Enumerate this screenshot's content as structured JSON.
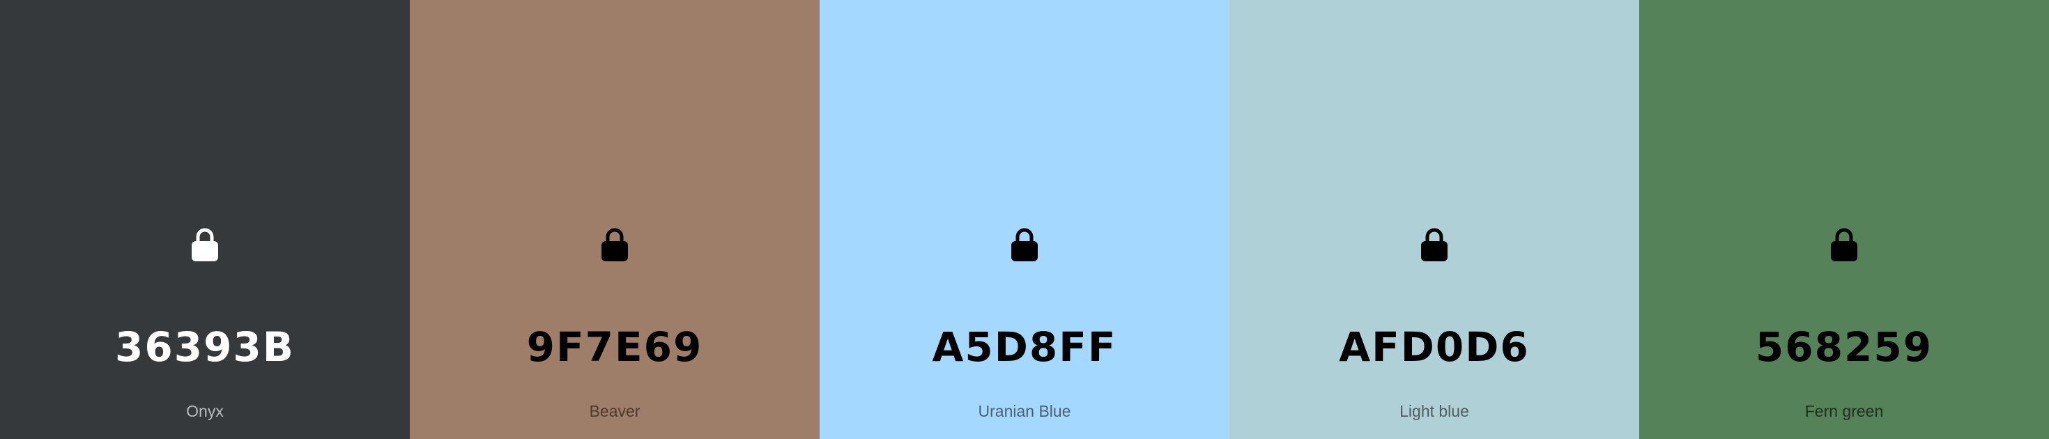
{
  "palette": {
    "colors": [
      {
        "hex": "36393B",
        "name": "Onyx",
        "background": "#36393B",
        "text_color": "#FFFFFF",
        "name_color": "#B9BBBC",
        "icon_color": "#FFFFFF",
        "icon": "lock-icon"
      },
      {
        "hex": "9F7E69",
        "name": "Beaver",
        "background": "#9F7E69",
        "text_color": "#000000",
        "name_color": "#4B3A30",
        "icon_color": "#000000",
        "icon": "lock-icon"
      },
      {
        "hex": "A5D8FF",
        "name": "Uranian Blue",
        "background": "#A5D8FF",
        "text_color": "#000000",
        "name_color": "#4A6173",
        "icon_color": "#000000",
        "icon": "lock-icon"
      },
      {
        "hex": "AFD0D6",
        "name": "Light blue",
        "background": "#AFD0D6",
        "text_color": "#000000",
        "name_color": "#4E5D60",
        "icon_color": "#000000",
        "icon": "lock-icon"
      },
      {
        "hex": "568259",
        "name": "Fern green",
        "background": "#568259",
        "text_color": "#000000",
        "name_color": "#1F2F20",
        "icon_color": "#000000",
        "icon": "lock-icon"
      }
    ]
  }
}
